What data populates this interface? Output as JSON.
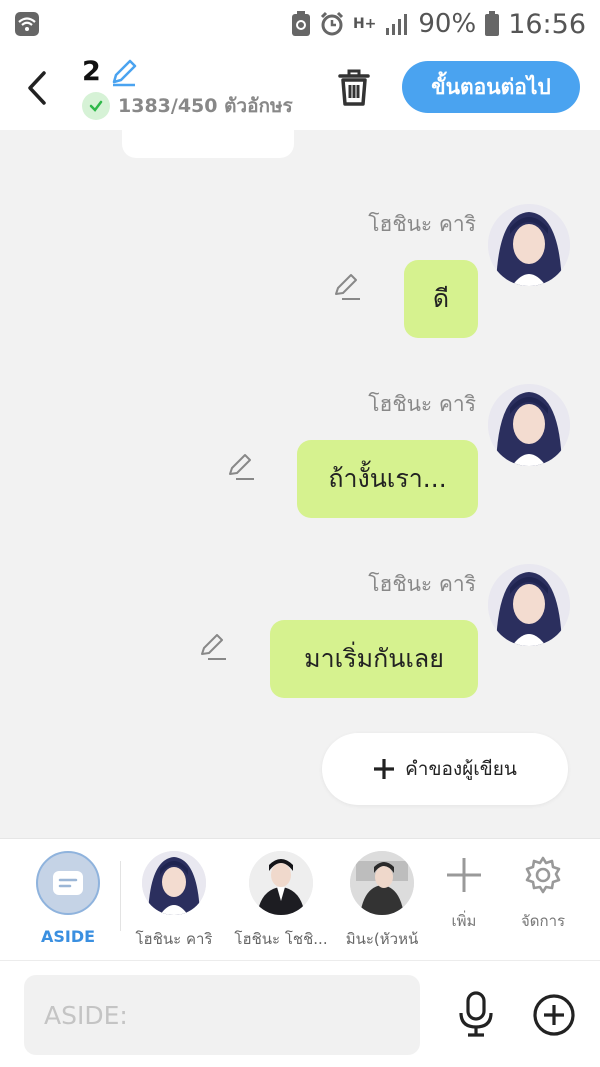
{
  "status_bar": {
    "battery": "90%",
    "time": "16:56",
    "network": "H+"
  },
  "header": {
    "episode_number": "2",
    "char_count": "1383/450 ตัวอักษร",
    "next_button": "ขั้นตอนต่อไป"
  },
  "messages": [
    {
      "sender": "โฮชินะ คาริ",
      "text": "ดี"
    },
    {
      "sender": "โฮชินะ คาริ",
      "text": "ถ้างั้นเรา..."
    },
    {
      "sender": "โฮชินะ คาริ",
      "text": "มาเริ่มกันเลย"
    }
  ],
  "author_button": "คำของผู้เขียน",
  "characters": [
    {
      "label": "ASIDE"
    },
    {
      "label": "โฮชินะ คาริ"
    },
    {
      "label": "โฮชินะ โชชิ..."
    },
    {
      "label": "มินะ(หัวหน้"
    }
  ],
  "tools": {
    "add": "เพิ่ม",
    "manage": "จัดการ"
  },
  "input": {
    "placeholder": "ASIDE:"
  },
  "colors": {
    "accent": "#4aa3f0",
    "bubble": "#d6f28f",
    "background": "#f2f2f2"
  }
}
